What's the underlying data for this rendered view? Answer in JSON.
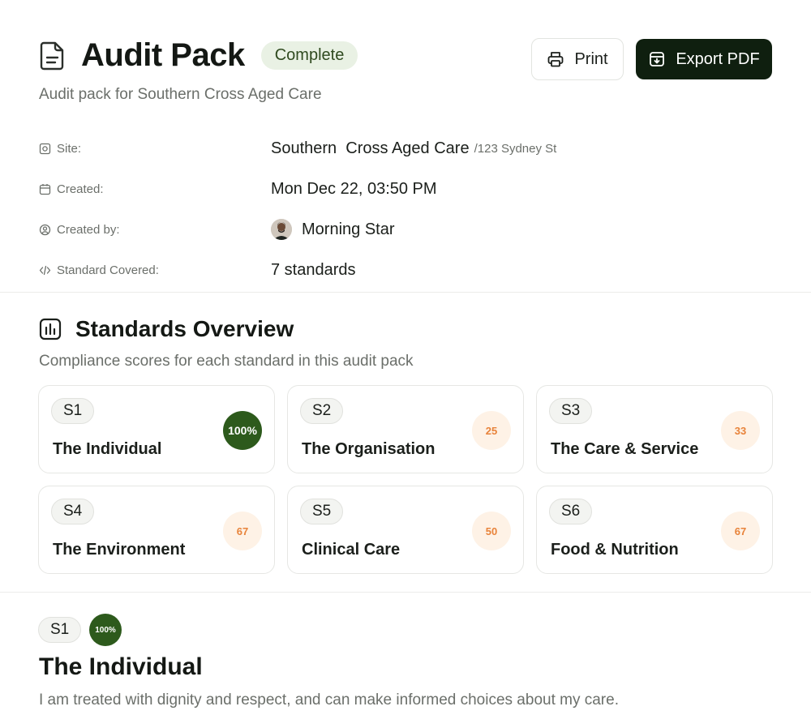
{
  "header": {
    "title": "Audit Pack",
    "status": "Complete",
    "subtitle": "Audit pack for Southern Cross Aged Care",
    "print_label": "Print",
    "export_label": "Export PDF"
  },
  "meta": {
    "site_label": "Site:",
    "site_value": "Southern  Cross Aged Care",
    "site_address": "/123 Sydney St",
    "created_label": "Created:",
    "created_value": "Mon Dec 22, 03:50 PM",
    "created_by_label": "Created by:",
    "created_by_value": "Morning Star",
    "standards_label": "Standard Covered:",
    "standards_value": "7 standards"
  },
  "overview": {
    "title": "Standards Overview",
    "subtitle": "Compliance scores for each standard in this audit pack",
    "cards": [
      {
        "code": "S1",
        "name": "The Individual",
        "score": "100%"
      },
      {
        "code": "S2",
        "name": "The Organisation",
        "score": "25"
      },
      {
        "code": "S3",
        "name": "The Care & Service",
        "score": "33"
      },
      {
        "code": "S4",
        "name": "The Environment",
        "score": "67"
      },
      {
        "code": "S5",
        "name": "Clinical Care",
        "score": "50"
      },
      {
        "code": "S6",
        "name": "Food & Nutrition",
        "score": "67"
      }
    ]
  },
  "detail": {
    "code": "S1",
    "score": "100%",
    "title": "The Individual",
    "description": "I am treated with dignity and respect, and can make informed choices about my care."
  },
  "colors": {
    "accent_dark": "#0f1f0f",
    "score_full": "#2d5a1c",
    "score_partial_bg": "#fef2e6",
    "score_partial_text": "#e8833a",
    "status_bg": "#e9f1e4"
  }
}
